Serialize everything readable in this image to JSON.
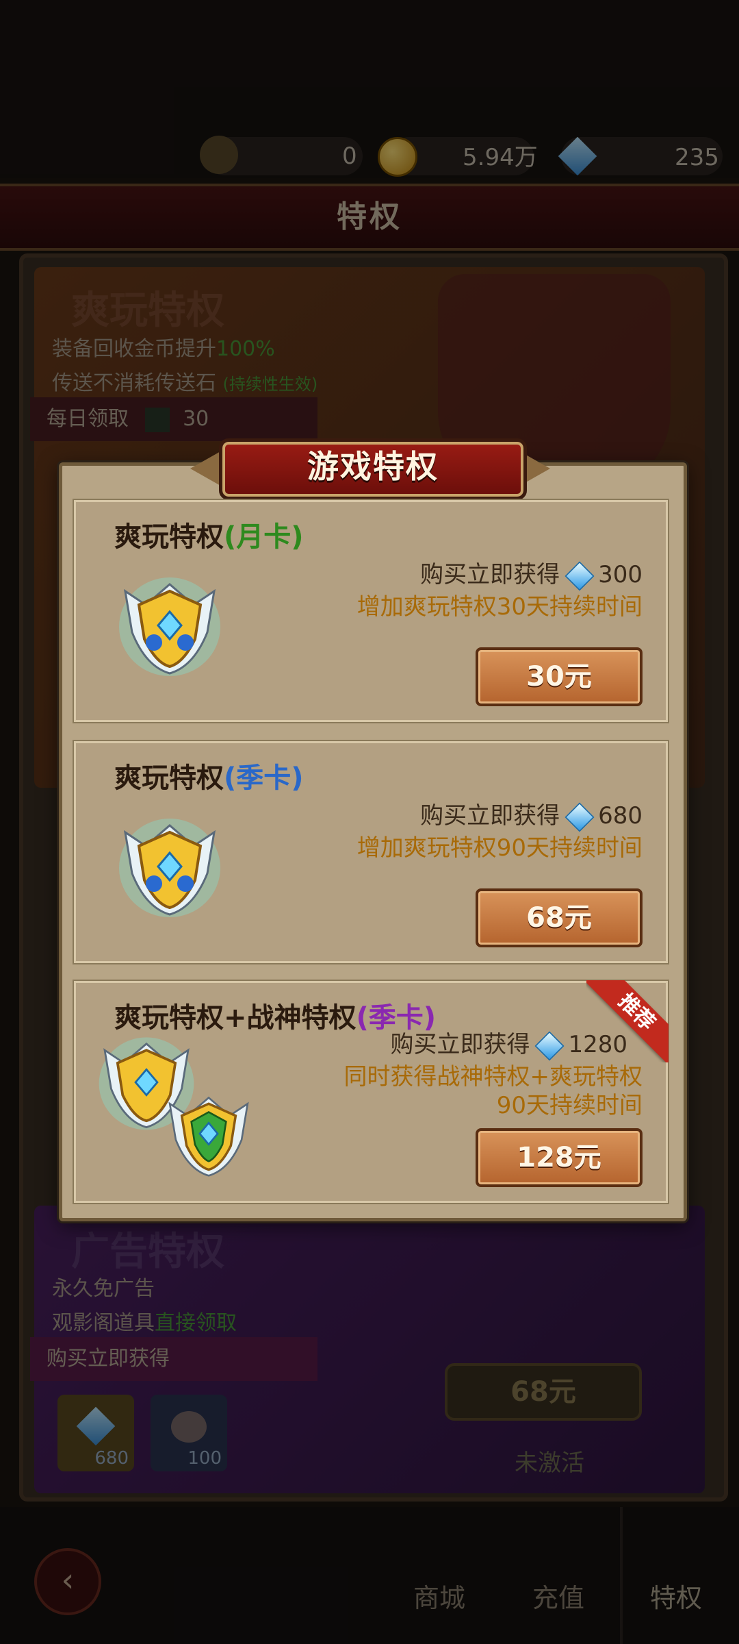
{
  "background": {
    "resources": {
      "trophy": "0",
      "gold": "5.94万",
      "diamonds": "235"
    },
    "page_title": "特权",
    "vip_card": {
      "title": "爽玩特权",
      "line1_prefix": "装备回收金币提升",
      "line1_value": "100%",
      "line2_prefix": "传送不消耗传送石",
      "line2_note": "(持续性生效)",
      "daily_label": "每日领取",
      "daily_value": "30"
    },
    "ad_card": {
      "title": "广告特权",
      "line1": "永久免广告",
      "line2_prefix": "观影阁道具",
      "line2_highlight": "直接领取",
      "buy_label": "购买立即获得",
      "item1_count": "680",
      "item2_count": "100",
      "price": "68元",
      "status": "未激活"
    },
    "nav": {
      "shop": "商城",
      "recharge": "充值",
      "privilege": "特权"
    }
  },
  "modal": {
    "title": "游戏特权",
    "offers": [
      {
        "name": "爽玩特权",
        "tag": "(月卡)",
        "gain_label": "购买立即获得",
        "gain_amount": "300",
        "desc1": "增加爽玩特权30天持续时间",
        "desc2": "",
        "price": "30元"
      },
      {
        "name": "爽玩特权",
        "tag": "(季卡)",
        "gain_label": "购买立即获得",
        "gain_amount": "680",
        "desc1": "增加爽玩特权90天持续时间",
        "desc2": "",
        "price": "68元"
      },
      {
        "name": "爽玩特权+战神特权",
        "tag": "(季卡)",
        "gain_label": "购买立即获得",
        "gain_amount": "1280",
        "desc1": "同时获得战神特权+爽玩特权",
        "desc2": "90天持续时间",
        "price": "128元",
        "badge": "推荐"
      }
    ]
  },
  "colors": {
    "month_tag": "#2e8a1e",
    "season_tag": "#2a68c8",
    "combo_tag": "#8a28b0",
    "desc": "#a86a08"
  }
}
